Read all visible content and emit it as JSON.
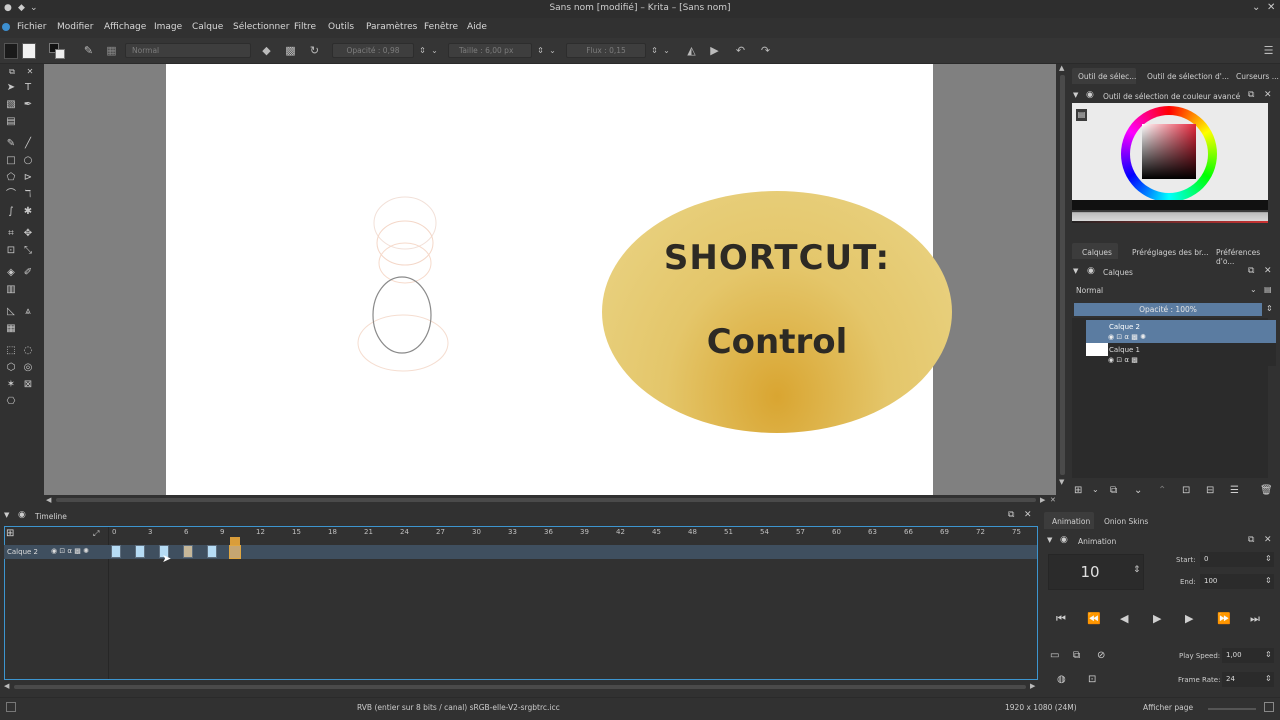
{
  "window": {
    "title": "Sans nom [modifié] – Krita – [Sans nom]"
  },
  "menu": [
    "Fichier",
    "Modifier",
    "Affichage",
    "Image",
    "Calque",
    "Sélectionner",
    "Filtre",
    "Outils",
    "Paramètres",
    "Fenêtre",
    "Aide"
  ],
  "toolbar": {
    "blend_mode": "Normal",
    "opacity_label": "Opacité : 0,98",
    "size_label": "Taille : 6,00 px",
    "flow_label": "Flux : 0,15"
  },
  "canvas": {
    "bubble_title": "SHORTCUT:",
    "bubble_text": "Control",
    "bubble_color": "#e4c66a"
  },
  "right_dock": {
    "top_tabs": [
      "Outil de sélec...",
      "Outil de sélection d'...",
      "Curseurs ..."
    ],
    "color_panel_title": "Outil de sélection de couleur avancé",
    "layer_tabs": [
      "Calques",
      "Préréglages des br...",
      "Préférences d'o..."
    ],
    "layers_panel_title": "Calques",
    "blend_mode": "Normal",
    "opacity": "Opacité : 100%",
    "layers": [
      {
        "name": "Calque 2",
        "selected": true
      },
      {
        "name": "Calque 1",
        "selected": false
      }
    ]
  },
  "timeline": {
    "title": "Timeline",
    "layer_name": "Calque 2",
    "ticks": [
      "0",
      "3",
      "6",
      "9",
      "12",
      "15",
      "18",
      "21",
      "24",
      "27",
      "30",
      "33",
      "36",
      "39",
      "42",
      "45",
      "48",
      "51",
      "54",
      "57",
      "60",
      "63",
      "66",
      "69",
      "72",
      "75"
    ],
    "keyframes": [
      0,
      2,
      4,
      6,
      8
    ],
    "current_frame": 10
  },
  "animation": {
    "tabs": [
      "Animation",
      "Onion Skins"
    ],
    "panel_title": "Animation",
    "current_frame": "10",
    "start_label": "Start:",
    "start_value": "0",
    "end_label": "End:",
    "end_value": "100",
    "play_speed_label": "Play Speed:",
    "play_speed_value": "1,00",
    "frame_rate_label": "Frame Rate:",
    "frame_rate_value": "24"
  },
  "status": {
    "color_profile": "RVB (entier sur 8 bits / canal)  sRGB-elle-V2-srgbtrc.icc",
    "dimensions": "1920 x 1080 (24M)",
    "view_mode": "Afficher page"
  }
}
